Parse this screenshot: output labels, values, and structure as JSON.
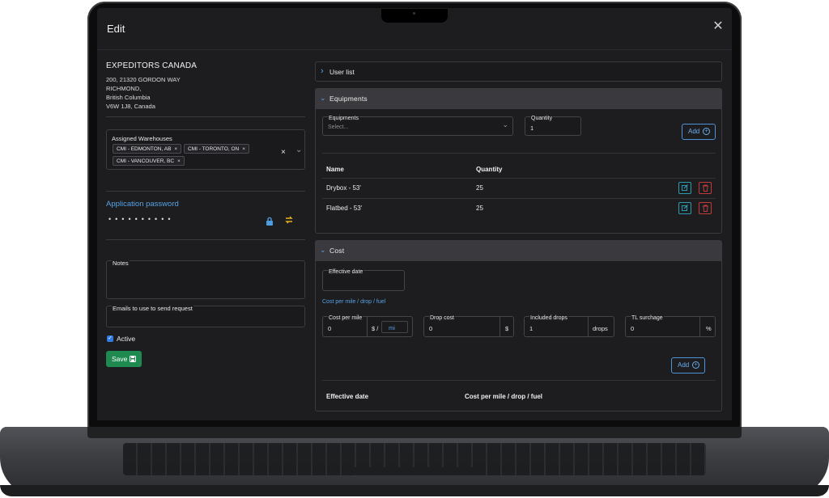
{
  "modal": {
    "title": "Edit"
  },
  "company": {
    "name": "EXPEDITORS CANADA",
    "address_lines": [
      "200, 21320 GORDON WAY",
      "RICHMOND,",
      "British Columbia",
      "V6W 1J8, Canada"
    ]
  },
  "warehouses": {
    "label": "Assigned Warehouses",
    "chips": [
      "CMI - EDMONTON, AB",
      "CMI - TORONTO, ON",
      "CMI - VANCOUVER, BC"
    ],
    "chip_remove": "×",
    "clear": "×",
    "dropdown": "⌄"
  },
  "app_password": {
    "label": "Application password",
    "masked": "••••••••••"
  },
  "notes": {
    "label": "Notes",
    "value": ""
  },
  "emails": {
    "label": "Emails to use to send request",
    "value": ""
  },
  "active": {
    "label": "Active",
    "checked": true,
    "check": "✓"
  },
  "save": {
    "label": "Save"
  },
  "user_list": {
    "title": "User list",
    "chevron": "›"
  },
  "equipments": {
    "title": "Equipments",
    "chevron": "⌄",
    "select_label": "Equipments",
    "select_placeholder": "Select...",
    "select_arrow": "⌄",
    "quantity_label": "Quantity",
    "quantity_value": "1",
    "add_label": "Add",
    "add_icon": "+",
    "columns": [
      "Name",
      "Quantity"
    ],
    "rows": [
      {
        "name": "Drybox - 53'",
        "quantity": "25"
      },
      {
        "name": "Flatbed - 53'",
        "quantity": "25"
      }
    ]
  },
  "cost": {
    "title": "Cost",
    "chevron": "⌄",
    "effective_date_label": "Effective date",
    "toggle_link": "Cost per mile / drop / fuel",
    "cost_per_mile": {
      "label": "Cost per mile",
      "value": "0",
      "unit": "$ /",
      "unit_select": "mi"
    },
    "drop_cost": {
      "label": "Drop cost",
      "value": "0",
      "unit": "$"
    },
    "included_drops": {
      "label": "Included drops",
      "value": "1",
      "unit": "drops"
    },
    "tl_surcharge": {
      "label": "TL surchage",
      "value": "0",
      "unit": "%"
    },
    "add_label": "Add",
    "add_icon": "+",
    "columns": [
      "Effective date",
      "Cost per mile / drop / fuel"
    ]
  },
  "icons": {
    "close": "close-icon",
    "lock": "lock-icon",
    "refresh": "refresh-icon",
    "edit": "edit-icon",
    "delete": "trash-icon",
    "save": "save-icon"
  },
  "colors": {
    "accent": "#56a3e6",
    "success": "#1e8a4f",
    "danger": "#c23b3b",
    "info": "#2b9bb0",
    "warning": "#e3b51c",
    "background": "#1d1c1f"
  }
}
